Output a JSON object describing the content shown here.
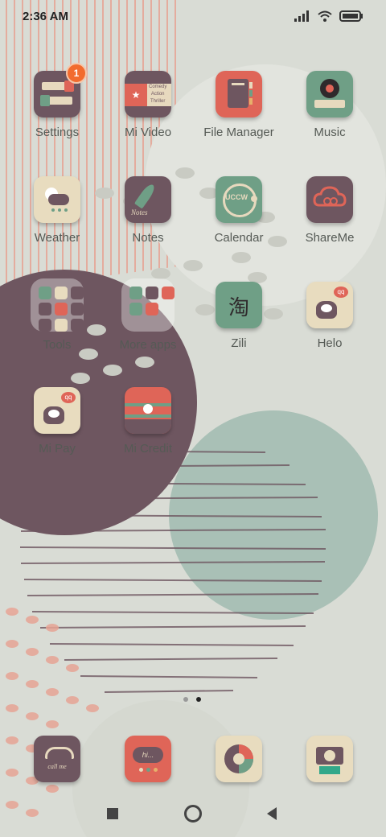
{
  "status": {
    "time": "2:36 AM"
  },
  "apps": [
    {
      "label": "Settings",
      "badge": "1",
      "icon": "settings-icon"
    },
    {
      "label": "Mi Video",
      "icon": "video-icon",
      "lines": [
        "Comedy",
        "Action",
        "Thriller"
      ]
    },
    {
      "label": "File Manager",
      "icon": "file-manager-icon"
    },
    {
      "label": "Music",
      "icon": "music-icon"
    },
    {
      "label": "Weather",
      "icon": "weather-icon"
    },
    {
      "label": "Notes",
      "icon": "notes-icon",
      "text": "Notes"
    },
    {
      "label": "Calendar",
      "icon": "calendar-icon",
      "text": "UCCW"
    },
    {
      "label": "ShareMe",
      "icon": "shareme-icon"
    },
    {
      "label": "Tools",
      "icon": "folder-icon"
    },
    {
      "label": "More apps",
      "icon": "folder-icon"
    },
    {
      "label": "Zili",
      "icon": "zili-icon",
      "text": "淘"
    },
    {
      "label": "Helo",
      "icon": "helo-icon",
      "text": "qq"
    },
    {
      "label": "Mi Pay",
      "icon": "mipay-icon",
      "text": "qq"
    },
    {
      "label": "Mi Credit",
      "icon": "micredit-icon"
    }
  ],
  "dock": [
    {
      "icon": "phone-icon",
      "text": "call me"
    },
    {
      "icon": "messages-icon",
      "text": "hi..."
    },
    {
      "icon": "browser-icon"
    },
    {
      "icon": "camera-icon"
    }
  ],
  "colors": {
    "maroon": "#6e5660",
    "coral": "#df6558",
    "teal": "#6f9f86",
    "cream": "#e8dcbf"
  }
}
